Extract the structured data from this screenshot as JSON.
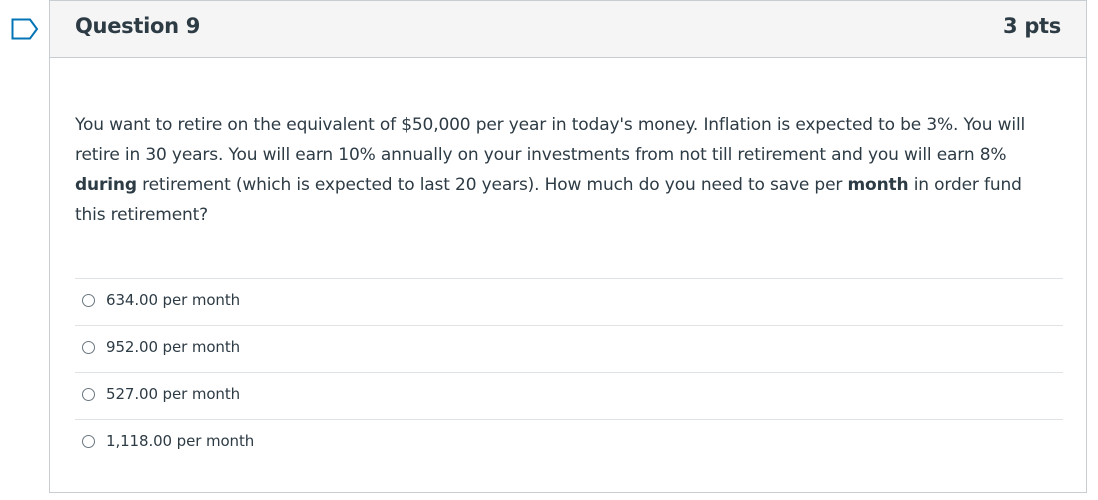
{
  "question": {
    "title": "Question 9",
    "points": "3 pts",
    "text_parts": [
      "You want to retire on the equivalent of $50,000 per year in today's money. Inflation is expected to be 3%. You will retire in 30 years. You will earn 10% annually on your investments from not till retirement and you will earn 8% ",
      "during",
      " retirement (which is expected to last 20 years). How much do you need to save per ",
      "month",
      " in order fund this retirement?"
    ]
  },
  "answers": [
    {
      "label": "634.00 per month"
    },
    {
      "label": "952.00 per month"
    },
    {
      "label": "527.00 per month"
    },
    {
      "label": "1,118.00 per month"
    }
  ],
  "colors": {
    "flag": "#0374b5",
    "header_bg": "#f5f5f5",
    "border": "#c7cdd1",
    "text": "#2d3b45"
  }
}
